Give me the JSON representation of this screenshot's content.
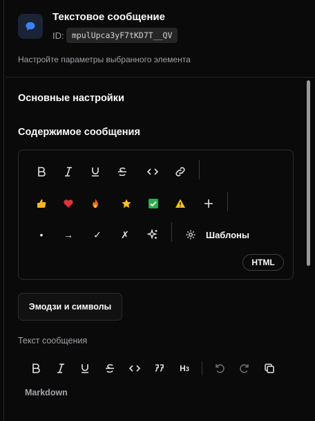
{
  "header": {
    "title": "Текстовое сообщение",
    "id_label": "ID:",
    "id_value": "mpulUpca3yF7tKD7T__QV",
    "subtitle": "Настройте параметры выбранного элемента",
    "icon": "chat-bubble-icon"
  },
  "sections": {
    "basic_settings": "Основные настройки",
    "message_content": "Содержимое сообщения"
  },
  "editor": {
    "format_toolbar": [
      {
        "name": "bold-button",
        "glyph": "B"
      },
      {
        "name": "italic-button",
        "glyph": "I"
      },
      {
        "name": "underline-button",
        "glyph": "U"
      },
      {
        "name": "strikethrough-button",
        "glyph": "S"
      },
      {
        "name": "code-button",
        "glyph": "<>"
      },
      {
        "name": "link-button",
        "glyph": "link"
      }
    ],
    "emoji_row": [
      {
        "name": "thumbs-up-emoji-button",
        "glyph": "👍"
      },
      {
        "name": "heart-emoji-button",
        "glyph": "❤"
      },
      {
        "name": "fire-emoji-button",
        "glyph": "🔥"
      },
      {
        "name": "star-emoji-button",
        "glyph": "★"
      },
      {
        "name": "check-mark-emoji-button",
        "glyph": "✓"
      },
      {
        "name": "warning-emoji-button",
        "glyph": "⚠"
      },
      {
        "name": "plus-button",
        "glyph": "+"
      }
    ],
    "symbol_row": [
      {
        "name": "bullet-symbol-button",
        "glyph": "•"
      },
      {
        "name": "arrow-symbol-button",
        "glyph": "→"
      },
      {
        "name": "check-symbol-button",
        "glyph": "✓"
      },
      {
        "name": "cross-symbol-button",
        "glyph": "✗"
      },
      {
        "name": "sparkles-button",
        "glyph": "sparkles"
      }
    ],
    "templates_label": "Шаблоны",
    "html_label": "HTML"
  },
  "emoji_symbols_button": "Эмодзи и символы",
  "message_text": {
    "label": "Текст сообщения",
    "toolbar": [
      {
        "name": "md-bold-button",
        "glyph": "B"
      },
      {
        "name": "md-italic-button",
        "glyph": "I"
      },
      {
        "name": "md-underline-button",
        "glyph": "U"
      },
      {
        "name": "md-strikethrough-button",
        "glyph": "S"
      },
      {
        "name": "md-code-button",
        "glyph": "<>"
      },
      {
        "name": "md-quote-button",
        "glyph": "quote"
      },
      {
        "name": "md-heading-button",
        "glyph": "H3"
      },
      {
        "name": "undo-button",
        "glyph": "undo"
      },
      {
        "name": "redo-button",
        "glyph": "redo"
      },
      {
        "name": "copy-button",
        "glyph": "copy"
      }
    ],
    "mode_label": "Markdown"
  },
  "colors": {
    "background": "#0a0a0a",
    "border": "#2e2e2e",
    "text": "#fafafa",
    "muted": "#a1a1aa",
    "icon_bg": "#1b2436",
    "icon_fg": "#3b82f6"
  }
}
